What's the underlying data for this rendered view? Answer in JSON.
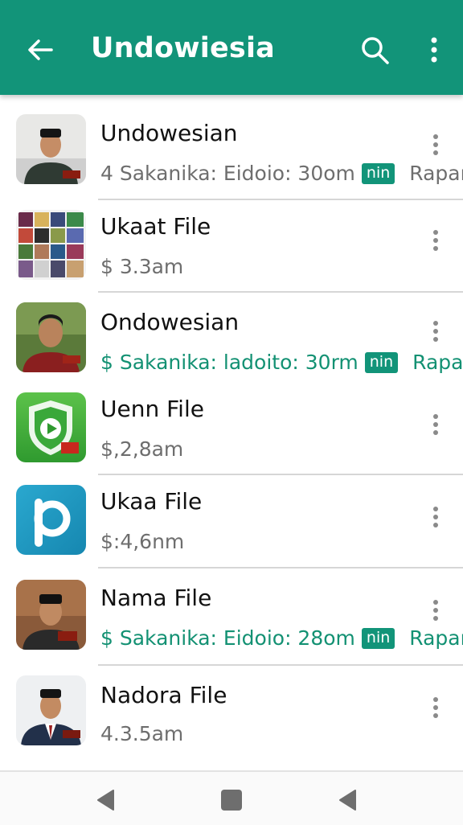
{
  "appbar": {
    "title": "Undowiesia",
    "back_icon": "arrow-back-icon",
    "search_icon": "search-icon",
    "more_icon": "more-vert-icon",
    "color": "#129479"
  },
  "items": [
    {
      "name": "Undowesian",
      "meta": "4 Sakanika: Eidoio: 30om",
      "badge": "nin",
      "suffix": "Rapar",
      "style": "grey",
      "thumb": "portrait-man-cap"
    },
    {
      "name": "Ukaat File",
      "meta": "$ 3.3am",
      "style": "grey",
      "thumb": "photo-collage"
    },
    {
      "name": "Ondowesian",
      "meta": "$ Sakanika: ladoito: 30rm",
      "badge": "nin",
      "suffix": "Rapar",
      "style": "green",
      "thumb": "portrait-man-outdoor"
    },
    {
      "name": "Uenn File",
      "meta": "$,2,8am",
      "style": "grey",
      "thumb": "green-shield-play-app-icon"
    },
    {
      "name": "Ukaa File",
      "meta": "$:4,6nm",
      "style": "grey",
      "thumb": "blue-p-app-icon"
    },
    {
      "name": "Nama File",
      "meta": "$ Sakanika: Eidoio: 28om",
      "badge": "nin",
      "suffix": "Rapar",
      "style": "green",
      "thumb": "portrait-man-cap-indoor"
    },
    {
      "name": "Nadora File",
      "meta": "4.3.5am",
      "style": "grey",
      "thumb": "portrait-man-suit"
    }
  ],
  "navbar": {
    "back_icon": "nav-back-icon",
    "home_icon": "nav-home-icon",
    "recents_icon": "nav-recents-icon"
  }
}
